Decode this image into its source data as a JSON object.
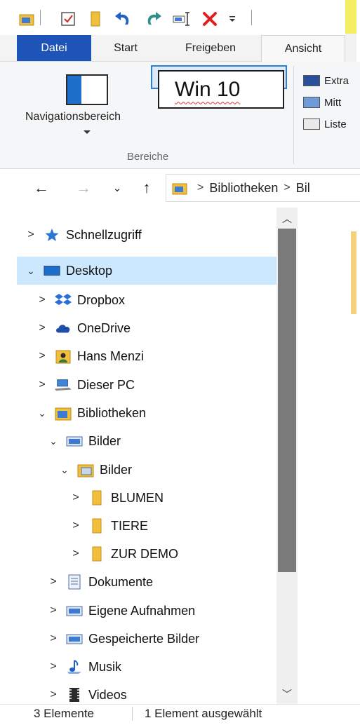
{
  "colors": {
    "file_tab": "#1e53b7",
    "selection": "#cce8ff",
    "folder_yellow": "#f2bf3a",
    "accent_blue": "#1e6fc9",
    "delete_red": "#e02020"
  },
  "quick_access": {
    "items": [
      "folder-icon",
      "properties-icon",
      "new-folder-icon",
      "undo-icon",
      "redo-icon",
      "rename-icon",
      "delete-icon",
      "customize-dropdown-icon"
    ]
  },
  "ribbon": {
    "tabs": [
      {
        "label": "Datei"
      },
      {
        "label": "Start"
      },
      {
        "label": "Freigeben"
      },
      {
        "label": "Ansicht"
      }
    ],
    "nav_pane_label": "Navigationsbereich",
    "group_label": "Bereiche",
    "callout_text": "Win 10",
    "layouts": [
      "Extra",
      "Mitt",
      "Liste"
    ]
  },
  "address_bar": {
    "breadcrumb": [
      "Bibliotheken",
      "Bil"
    ]
  },
  "tree": {
    "items": [
      {
        "label": "Schnellzugriff",
        "icon": "star-icon",
        "expanded": false,
        "depth": 0
      },
      {
        "label": "Desktop",
        "icon": "desktop-icon",
        "expanded": true,
        "depth": 0,
        "selected": true
      },
      {
        "label": "Dropbox",
        "icon": "dropbox-icon",
        "expanded": false,
        "depth": 1
      },
      {
        "label": "OneDrive",
        "icon": "cloud-icon",
        "expanded": false,
        "depth": 1
      },
      {
        "label": "Hans Menzi",
        "icon": "user-folder-icon",
        "expanded": false,
        "depth": 1
      },
      {
        "label": "Dieser PC",
        "icon": "computer-icon",
        "expanded": false,
        "depth": 1
      },
      {
        "label": "Bibliotheken",
        "icon": "library-icon",
        "expanded": true,
        "depth": 1
      },
      {
        "label": "Bilder",
        "icon": "pictures-library-icon",
        "expanded": true,
        "depth": 2
      },
      {
        "label": "Bilder",
        "icon": "pictures-folder-icon",
        "expanded": true,
        "depth": 3
      },
      {
        "label": "BLUMEN",
        "icon": "folder-icon",
        "expanded": false,
        "depth": 4
      },
      {
        "label": "TIERE",
        "icon": "folder-icon",
        "expanded": false,
        "depth": 4
      },
      {
        "label": "ZUR DEMO",
        "icon": "folder-icon",
        "expanded": false,
        "depth": 4
      },
      {
        "label": "Dokumente",
        "icon": "documents-icon",
        "expanded": false,
        "depth": 2
      },
      {
        "label": "Eigene Aufnahmen",
        "icon": "pictures-library-icon",
        "expanded": false,
        "depth": 2
      },
      {
        "label": "Gespeicherte Bilder",
        "icon": "pictures-library-icon",
        "expanded": false,
        "depth": 2
      },
      {
        "label": "Musik",
        "icon": "music-icon",
        "expanded": false,
        "depth": 2
      },
      {
        "label": "Videos",
        "icon": "videos-icon",
        "expanded": false,
        "depth": 2
      }
    ]
  },
  "status_bar": {
    "count": "3 Elemente",
    "selection": "1 Element ausgewählt"
  }
}
